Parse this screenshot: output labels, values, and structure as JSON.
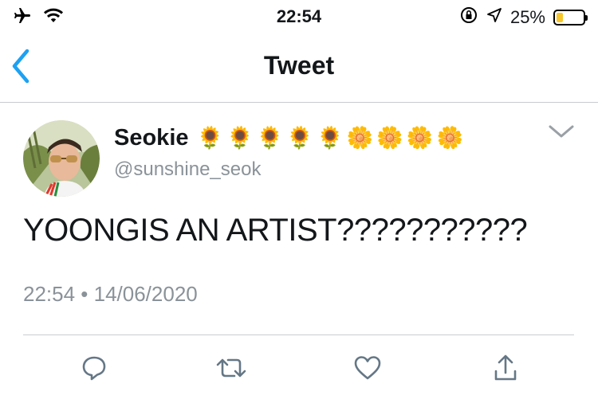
{
  "status_bar": {
    "time": "22:54",
    "battery_percent": "25%",
    "battery_level": 0.25,
    "icons": [
      "airplane-icon",
      "wifi-icon",
      "moon-icon",
      "orientation-lock-icon",
      "location-icon",
      "battery-icon"
    ]
  },
  "nav": {
    "title": "Tweet",
    "back_icon": "chevron-left-icon"
  },
  "tweet": {
    "display_name": "Seokie",
    "name_emoji": "🌻🌻🌻🌻🌻🌼🌼🌼🌼",
    "handle": "@sunshine_seok",
    "text": "YOONGIS AN ARTIST???????????",
    "timestamp": "22:54 • 14/06/2020"
  },
  "actions": [
    "reply-icon",
    "retweet-icon",
    "like-icon",
    "share-icon"
  ],
  "colors": {
    "accent": "#1da1f2",
    "secondary_text": "#8a9299",
    "icon_gray": "#657786",
    "divider": "#c8ccd0",
    "battery": "#f7c62d"
  }
}
